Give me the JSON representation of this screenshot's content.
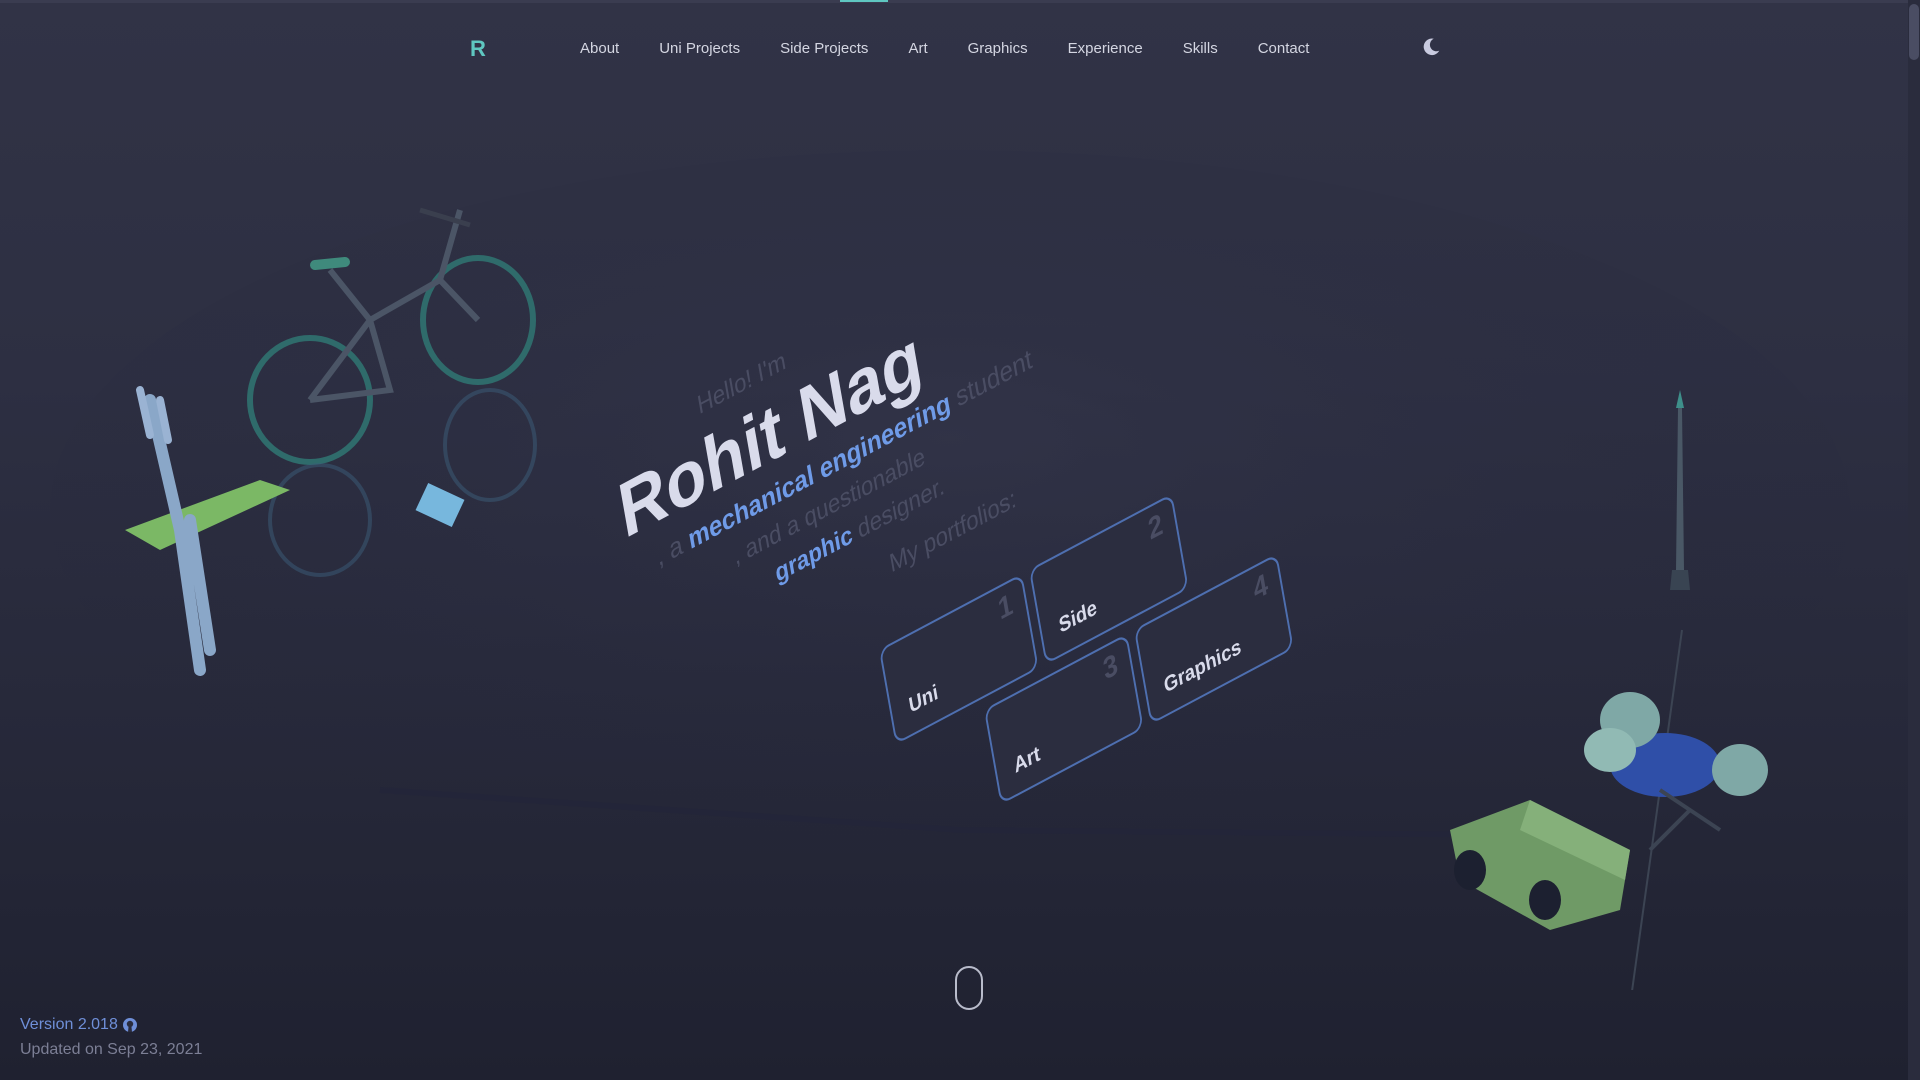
{
  "nav": {
    "logo": "R",
    "links": [
      "About",
      "Uni Projects",
      "Side Projects",
      "Art",
      "Graphics",
      "Experience",
      "Skills",
      "Contact"
    ],
    "theme_icon": "moon-icon"
  },
  "hero": {
    "greeting": "Hello! I'm",
    "name": "Rohit Nag",
    "line1_prefix": ", a",
    "line1_highlight": "mechanical engineering",
    "line1_suffix": "student",
    "line2": ", and a questionable",
    "line3_highlight": "graphic",
    "line3_suffix": "designer.",
    "portfolios_label": "My portfolios:"
  },
  "portfolio_tiles": [
    {
      "label": "Uni",
      "number": "1"
    },
    {
      "label": "Side",
      "number": "2"
    },
    {
      "label": "Art",
      "number": "3"
    },
    {
      "label": "Graphics",
      "number": "4"
    }
  ],
  "footer": {
    "version": "Version 2.018",
    "updated": "Updated on Sep 23, 2021",
    "github_icon": "github-icon"
  },
  "colors": {
    "accent": "#5fc7c1",
    "highlight": "#6f9be8",
    "background": "#2d2f42"
  }
}
